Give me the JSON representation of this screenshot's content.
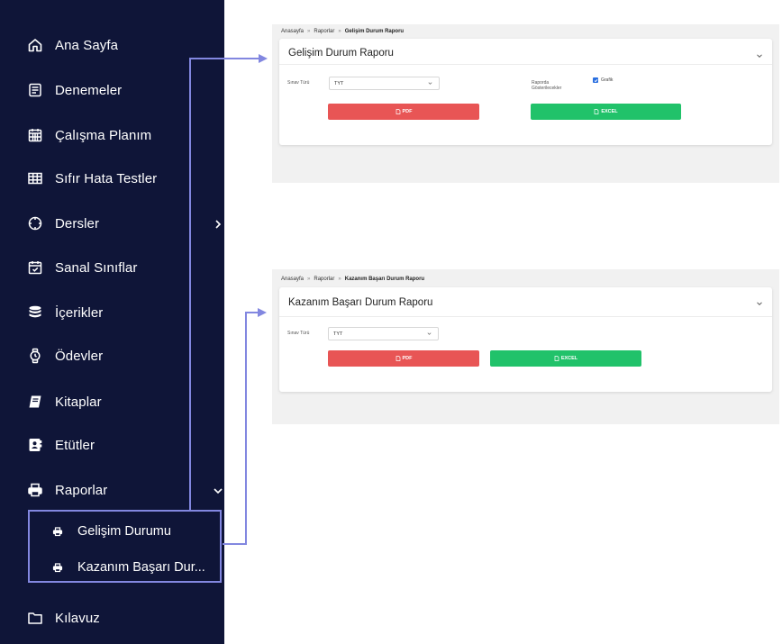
{
  "sidebar": {
    "items": [
      {
        "label": "Ana Sayfa",
        "icon": "home-icon"
      },
      {
        "label": "Denemeler",
        "icon": "document-list-icon"
      },
      {
        "label": "Çalışma Planım",
        "icon": "calendar-icon"
      },
      {
        "label": "Sıfır Hata Testler",
        "icon": "table-grid-icon"
      },
      {
        "label": "Dersler",
        "icon": "crosshair-icon"
      },
      {
        "label": "Sanal Sınıflar",
        "icon": "calendar-check-icon"
      },
      {
        "label": "İçerikler",
        "icon": "database-icon"
      },
      {
        "label": "Ödevler",
        "icon": "stopwatch-icon"
      },
      {
        "label": "Kitaplar",
        "icon": "book-icon"
      },
      {
        "label": "Etütler",
        "icon": "contact-card-icon"
      },
      {
        "label": "Raporlar",
        "icon": "printer-icon"
      },
      {
        "label": "Kılavuz",
        "icon": "folder-icon"
      }
    ],
    "submenu": [
      {
        "label": "Gelişim Durumu",
        "icon": "printer-icon"
      },
      {
        "label": "Kazanım Başarı Dur...",
        "icon": "printer-icon"
      }
    ]
  },
  "report1": {
    "breadcrumb": {
      "home": "Anasayfa",
      "section": "Raporlar",
      "current": "Gelişim Durum Raporu",
      "separator": "»"
    },
    "title": "Gelişim Durum Raporu",
    "exam_type_label": "Sınav Türü",
    "exam_type_value": "TYT",
    "show_in_report_label_line1": "Raporda",
    "show_in_report_label_line2": "Gösterilecekler",
    "chart_checkbox_label": "Grafik",
    "chart_checkbox_checked": true,
    "pdf_button": "PDF",
    "excel_button": "EXCEL"
  },
  "report2": {
    "breadcrumb": {
      "home": "Anasayfa",
      "section": "Raporlar",
      "current": "Kazanım Başarı Durum Raporu",
      "separator": "»"
    },
    "title": "Kazanım Başarı Durum Raporu",
    "exam_type_label": "Sınav Türü",
    "exam_type_value": "TYT",
    "pdf_button": "PDF",
    "excel_button": "EXCEL"
  },
  "colors": {
    "sidebar_bg": "#0f1538",
    "highlight": "#8287e0",
    "pdf": "#e85555",
    "excel": "#21c26a",
    "checkbox": "#2a6fe0"
  }
}
